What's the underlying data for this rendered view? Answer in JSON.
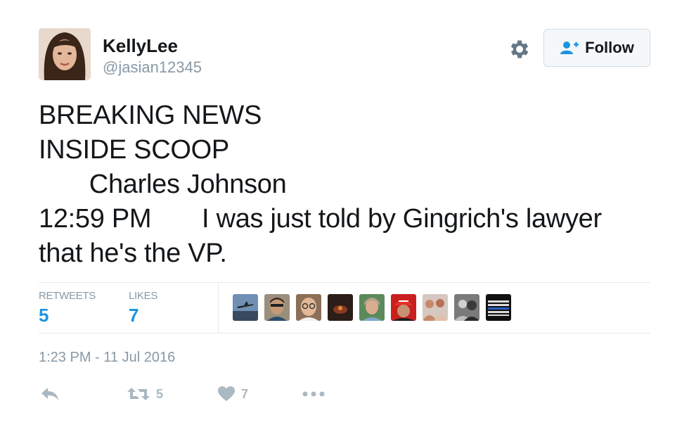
{
  "user": {
    "display_name": "KellyLee",
    "handle": "@jasian12345"
  },
  "header": {
    "follow_label": "Follow"
  },
  "tweet": {
    "lines": [
      "BREAKING NEWS",
      "INSIDE SCOOP",
      "       Charles Johnson",
      "12:59 PM       I was just told by Gingrich's lawyer",
      "that he's the VP."
    ]
  },
  "stats": {
    "retweets_label": "RETWEETS",
    "retweets_count": "5",
    "likes_label": "LIKES",
    "likes_count": "7"
  },
  "likers": [
    {
      "icon": "airplane-sky-avatar"
    },
    {
      "icon": "man-sunglasses-avatar"
    },
    {
      "icon": "man-glasses-avatar"
    },
    {
      "icon": "dark-scene-avatar"
    },
    {
      "icon": "woman-outdoor-avatar"
    },
    {
      "icon": "red-hat-avatar"
    },
    {
      "icon": "group-people-avatar"
    },
    {
      "icon": "bw-photo-avatar"
    },
    {
      "icon": "flag-logo-avatar"
    }
  ],
  "timestamp": "1:23 PM - 11 Jul 2016",
  "actions": {
    "retweet_count": "5",
    "like_count": "7"
  },
  "colors": {
    "accent": "#1b95e0",
    "muted": "#8899a6",
    "action_icon": "#aab8c2",
    "divider": "#e1e8ed"
  }
}
